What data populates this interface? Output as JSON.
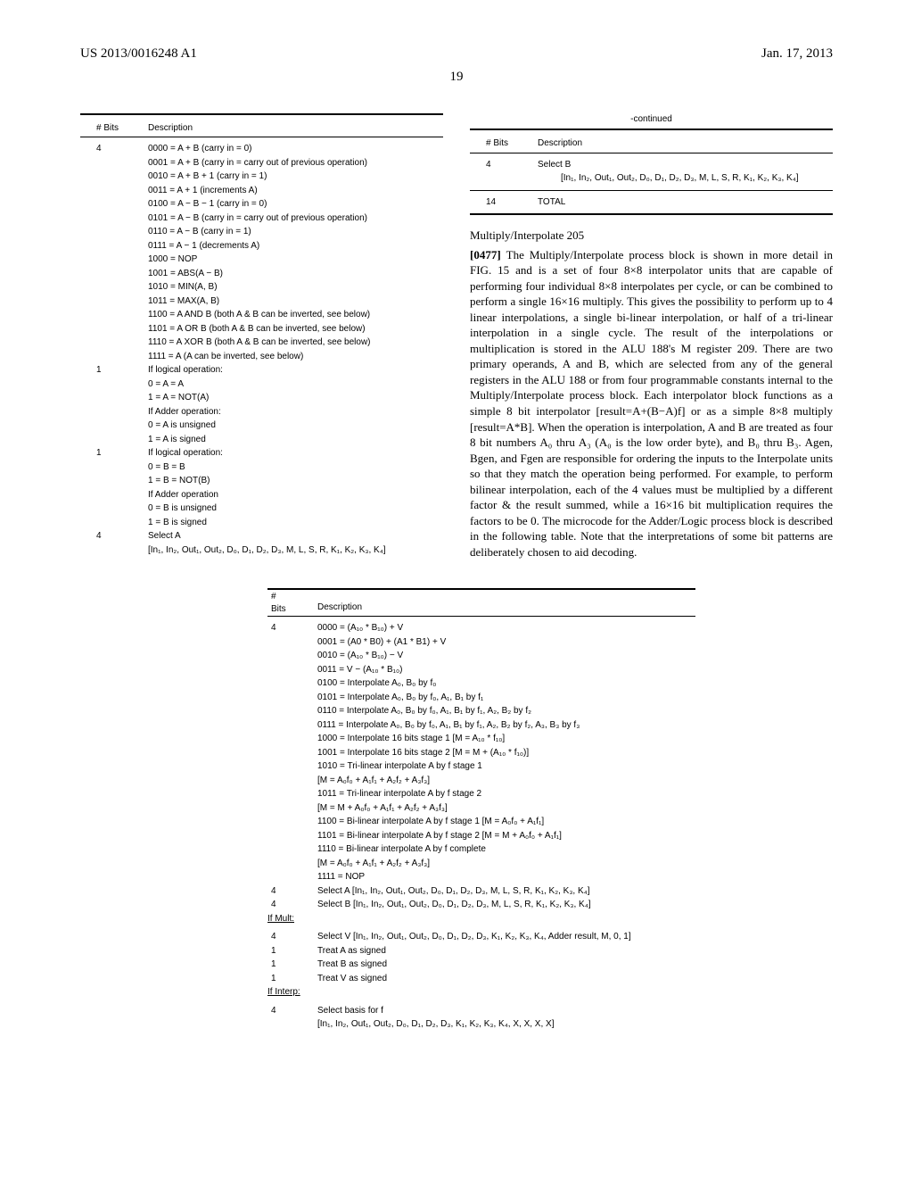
{
  "header": {
    "pub_number": "US 2013/0016248 A1",
    "date": "Jan. 17, 2013"
  },
  "page_number": "19",
  "table1": {
    "col_bits": "# Bits",
    "col_desc": "Description",
    "rows": [
      {
        "bits": "4",
        "lines": [
          "0000 = A + B (carry in = 0)",
          "0001 = A + B (carry in = carry out of previous operation)",
          "0010 = A + B + 1 (carry in = 1)",
          "0011 = A + 1 (increments A)",
          "0100 = A − B − 1 (carry in = 0)",
          "0101 = A − B (carry in = carry out of previous operation)",
          "0110 = A − B (carry in = 1)",
          "0111 = A − 1 (decrements A)",
          "1000 = NOP",
          "1001 = ABS(A − B)",
          "1010 = MIN(A, B)",
          "1011 = MAX(A, B)",
          "1100 = A AND B (both A & B can be inverted, see below)",
          "1101 = A OR B (both A & B can be inverted, see below)",
          "1110 = A XOR B (both A & B can be inverted, see below)",
          "1111 = A (A can be inverted, see below)"
        ]
      },
      {
        "bits": "1",
        "lines": [
          "If logical operation:",
          "0 = A = A",
          "1 = A = NOT(A)",
          "If Adder operation:",
          "0 = A is unsigned",
          "1 = A is signed"
        ]
      },
      {
        "bits": "1",
        "lines": [
          "If logical operation:",
          "0 = B = B",
          "1 = B = NOT(B)",
          "If Adder operation",
          "0 = B is unsigned",
          "1 = B is signed"
        ]
      },
      {
        "bits": "4",
        "lines": [
          "Select A",
          "[In₁, In₂, Out₁, Out₂, D₀, D₁, D₂, D₃, M, L, S, R, K₁, K₂, K₃, K₄]"
        ]
      }
    ]
  },
  "table2": {
    "continued_label": "-continued",
    "col_bits": "# Bits",
    "col_desc": "Description",
    "rows": [
      {
        "bits": "4",
        "lines": [
          "Select B",
          "[In₁, In₂, Out₁, Out₂, D₀, D₁, D₂, D₃, M, L, S, R, K₁, K₂, K₃, K₄]"
        ]
      },
      {
        "bits": "14",
        "lines": [
          "TOTAL"
        ]
      }
    ]
  },
  "section_title": "Multiply/Interpolate 205",
  "para_num": "[0477]",
  "paragraph": "The Multiply/Interpolate process block is shown in more detail in FIG. 15 and is a set of four 8×8 interpolator units that are capable of performing four individual 8×8 interpolates per cycle, or can be combined to perform a single 16×16 multiply. This gives the possibility to perform up to 4 linear interpolations, a single bi-linear interpolation, or half of a tri-linear interpolation in a single cycle. The result of the interpolations or multiplication is stored in the ALU 188's M register 209. There are two primary operands, A and B, which are selected from any of the general registers in the ALU 188 or from four programmable constants internal to the Multiply/Interpolate process block. Each interpolator block functions as a simple 8 bit interpolator [result=A+(B−A)f] or as a simple 8×8 multiply [result=A*B]. When the operation is interpolation, A and B are treated as four 8 bit numbers A₀ thru A₃ (A₀ is the low order byte), and B₀ thru B₃. Agen, Bgen, and Fgen are responsible for ordering the inputs to the Interpolate units so that they match the operation being performed. For example, to perform bilinear interpolation, each of the 4 values must be multiplied by a different factor & the result summed, while a 16×16 bit multiplication requires the factors to be 0. The microcode for the Adder/Logic process block is described in the following table. Note that the interpretations of some bit patterns are deliberately chosen to aid decoding.",
  "table3": {
    "col_bits_a": "#",
    "col_bits_b": "Bits",
    "col_desc": "Description",
    "rows": [
      {
        "bits": "4",
        "lines": [
          "0000 = (A₁₀ * B₁₀) + V",
          "0001 = (A0 * B0) + (A1 * B1) + V",
          "0010 = (A₁₀ * B₁₀) − V",
          "0011 = V − (A₁₀ * B₁₀)",
          "0100 = Interpolate A₀, B₀ by f₀",
          "0101 = Interpolate A₀, B₀ by f₀, A₁, B₁ by f₁",
          "0110 = Interpolate A₀, B₀ by f₀, A₁, B₁ by f₁, A₂, B₂ by f₂",
          "0111 = Interpolate A₀, B₀ by f₀, A₁, B₁ by f₁, A₂, B₂ by f₂, A₃, B₃ by f₃",
          "1000 = Interpolate 16 bits stage 1 [M = A₁₀ * f₁₀]",
          "1001 = Interpolate 16 bits stage 2 [M = M + (A₁₀ * f₁₀)]",
          "1010 = Tri-linear interpolate A by f stage 1",
          "[M = A₀f₀ + A₁f₁ + A₂f₂ + A₃f₃]",
          "1011 = Tri-linear interpolate A by f stage 2",
          "[M = M + A₀f₀ + A₁f₁ + A₂f₂ + A₃f₃]",
          "1100 = Bi-linear interpolate A by f stage 1 [M = A₀f₀ + A₁f₁]",
          "1101 = Bi-linear interpolate A by f stage 2 [M = M + A₀f₀ + A₁f₁]",
          "1110 = Bi-linear interpolate A by f complete",
          "[M = A₀f₀ + A₁f₁ + A₂f₂ + A₃f₃]",
          "1111 = NOP"
        ]
      },
      {
        "bits": "4",
        "lines": [
          "Select A [In₁, In₂, Out₁, Out₂, D₀, D₁, D₂, D₃, M, L, S, R, K₁, K₂, K₃, K₄]"
        ]
      },
      {
        "bits": "4",
        "lines": [
          "Select B [In₁, In₂, Out₁, Out₂, D₀, D₁, D₂, D₃, M, L, S, R, K₁, K₂, K₃, K₄]"
        ]
      }
    ],
    "if_mult": "If Mult:",
    "mult_rows": [
      {
        "bits": "4",
        "lines": [
          "Select V [In₁, In₂, Out₁, Out₂, D₀, D₁, D₂, D₃, K₁, K₂, K₃, K₄, Adder result, M, 0, 1]"
        ]
      },
      {
        "bits": "1",
        "lines": [
          "Treat A as signed"
        ]
      },
      {
        "bits": "1",
        "lines": [
          "Treat B as signed"
        ]
      },
      {
        "bits": "1",
        "lines": [
          "Treat V as signed"
        ]
      }
    ],
    "if_interp": "If Interp:",
    "interp_rows": [
      {
        "bits": "4",
        "lines": [
          "Select basis for f",
          "[In₁, In₂, Out₁, Out₂, D₀, D₁, D₂, D₃, K₁, K₂, K₃, K₄, X, X, X, X]"
        ]
      }
    ]
  }
}
